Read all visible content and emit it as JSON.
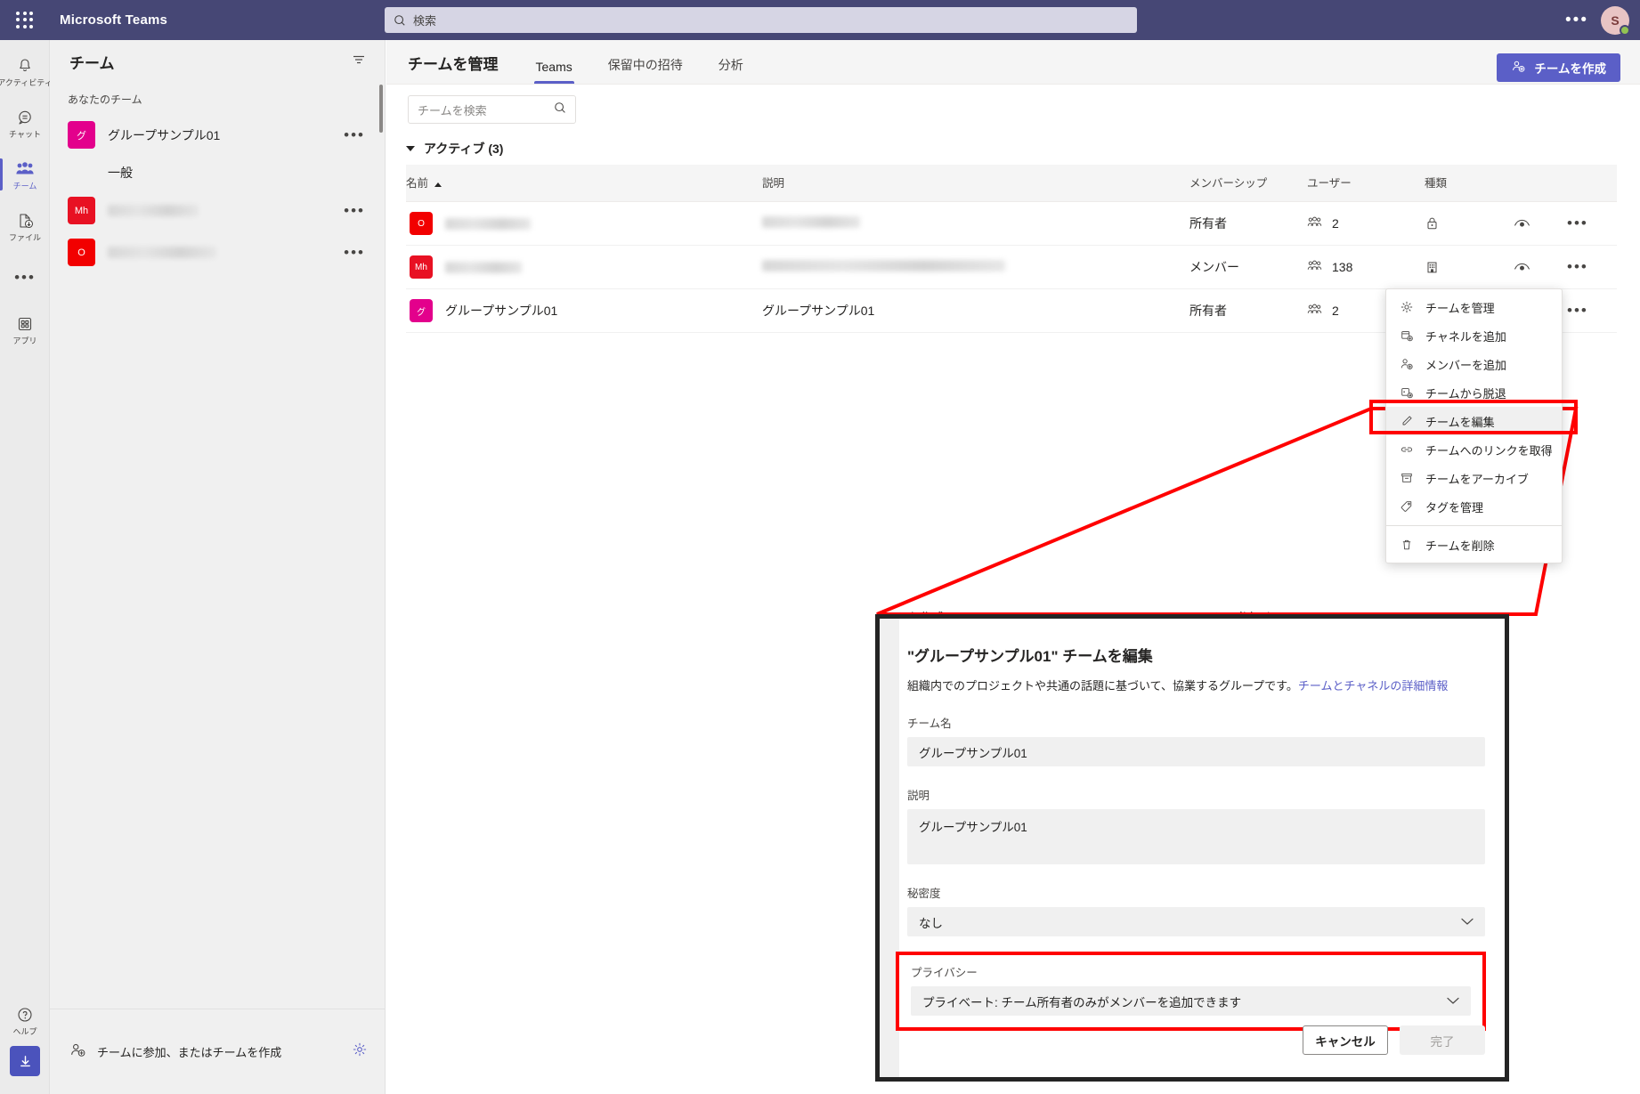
{
  "topbar": {
    "brand": "Microsoft Teams",
    "search_placeholder": "検索",
    "waffle_icon": "app-launcher-icon",
    "more_icon": "more-options-icon",
    "avatar_initial": "S"
  },
  "rail": {
    "items": [
      {
        "label": "アクティビティ",
        "icon": "bell-icon",
        "active": false
      },
      {
        "label": "チャット",
        "icon": "chat-icon",
        "active": false
      },
      {
        "label": "チーム",
        "icon": "people-icon",
        "active": true
      },
      {
        "label": "ファイル",
        "icon": "file-download-icon",
        "active": false
      },
      {
        "label": "",
        "icon": "more-dots-icon",
        "active": false
      },
      {
        "label": "アプリ",
        "icon": "apps-grid-icon",
        "active": false
      }
    ],
    "help": {
      "label": "ヘルプ",
      "icon": "help-circle-icon"
    },
    "download": {
      "icon": "download-arrow-icon"
    }
  },
  "panel": {
    "title": "チーム",
    "filter_icon": "filter-icon",
    "section_label": "あなたのチーム",
    "teams": [
      {
        "name": "グループサンプル01",
        "initial": "グ",
        "color": "#e3008c",
        "blurred": false,
        "blur_width": 0
      },
      {
        "name": "",
        "initial": "Mh",
        "color": "#e81123",
        "blurred": true,
        "blur_width": 102
      },
      {
        "name": "",
        "initial": "O",
        "color": "#f20000",
        "blurred": true,
        "blur_width": 122
      }
    ],
    "channel": "一般",
    "footer_label": "チームに参加、またはチームを作成",
    "footer_icon": "add-people-icon",
    "footer_gear_icon": "gear-icon"
  },
  "main": {
    "title": "チームを管理",
    "tabs": [
      {
        "label": "Teams",
        "active": true
      },
      {
        "label": "保留中の招待",
        "active": false
      },
      {
        "label": "分析",
        "active": false
      }
    ],
    "create_button": {
      "label": "チームを作成",
      "icon": "add-team-icon"
    },
    "search_placeholder": "チームを検索",
    "search_icon": "search-icon",
    "active_group_label": "アクティブ (3)",
    "columns": [
      "名前",
      "説明",
      "メンバーシップ",
      "ユーザー",
      "種類",
      "",
      ""
    ],
    "sort_column": "名前",
    "rows": [
      {
        "initial": "O",
        "color": "#f20000",
        "name": "",
        "name_blurred": true,
        "name_blur_width": 96,
        "description": "",
        "desc_blurred": true,
        "desc_blur_width": 110,
        "membership": "所有者",
        "users": "2",
        "type_icon": "lock-icon",
        "visibility_icon": "eye-icon",
        "more_icon": "more-options-icon"
      },
      {
        "initial": "Mh",
        "color": "#e81123",
        "name": "",
        "name_blurred": true,
        "name_blur_width": 86,
        "description": "",
        "desc_blurred": true,
        "desc_blur_width": 273,
        "membership": "メンバー",
        "users": "138",
        "type_icon": "building-icon",
        "visibility_icon": "eye-icon",
        "more_icon": "more-options-icon"
      },
      {
        "initial": "グ",
        "color": "#e3008c",
        "name": "グループサンプル01",
        "name_blurred": false,
        "name_blur_width": 0,
        "description": "グループサンプル01",
        "desc_blurred": false,
        "desc_blur_width": 0,
        "membership": "所有者",
        "users": "2",
        "type_icon": "",
        "visibility_icon": "",
        "more_icon": "more-options-icon"
      }
    ]
  },
  "context_menu": {
    "items": [
      {
        "label": "チームを管理",
        "icon": "gear-icon",
        "highlighted": false
      },
      {
        "label": "チャネルを追加",
        "icon": "add-channel-icon",
        "highlighted": false
      },
      {
        "label": "メンバーを追加",
        "icon": "add-member-icon",
        "highlighted": false
      },
      {
        "label": "チームから脱退",
        "icon": "leave-team-icon",
        "highlighted": false
      },
      {
        "label": "チームを編集",
        "icon": "pencil-icon",
        "highlighted": true
      },
      {
        "label": "チームへのリンクを取得",
        "icon": "link-icon",
        "highlighted": false
      },
      {
        "label": "チームをアーカイブ",
        "icon": "archive-icon",
        "highlighted": false
      },
      {
        "label": "タグを管理",
        "icon": "tag-icon",
        "highlighted": false
      }
    ],
    "delete_item": {
      "label": "チームを削除",
      "icon": "trash-icon"
    }
  },
  "dialog": {
    "title": "\"グループサンプル01\" チームを編集",
    "description": "組織内でのプロジェクトや共通の話題に基づいて、協業するグループです。",
    "link_text": "チームとチャネルの詳細情報",
    "name_label": "チーム名",
    "name_value": "グループサンプル01",
    "desc_label": "説明",
    "desc_value": "グループサンプル01",
    "sensitivity_label": "秘密度",
    "sensitivity_value": "なし",
    "privacy_label": "プライバシー",
    "privacy_value": "プライベート: チーム所有者のみがメンバーを追加できます",
    "cancel_label": "キャンセル",
    "done_label": "完了",
    "chevron_icon": "chevron-down-icon"
  },
  "background_ghost": {
    "left_text": "ムを作成",
    "right_text": "コードで、ムに参加する"
  },
  "colors": {
    "brand_purple": "#464775",
    "accent": "#5b5fc7",
    "highlight_red": "#ff0000",
    "dialog_border": "#242424"
  }
}
